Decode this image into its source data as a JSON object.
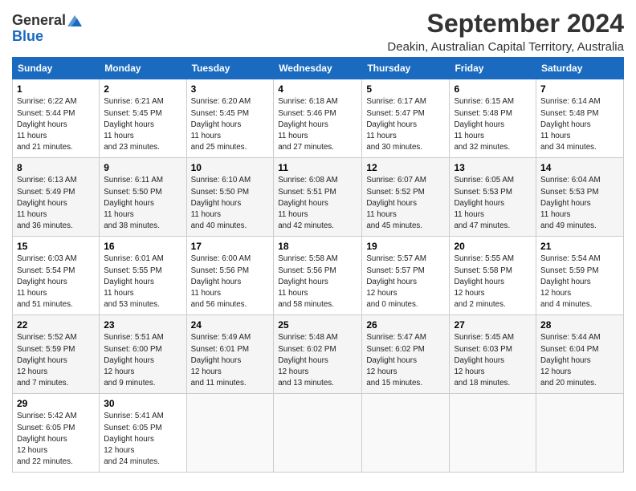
{
  "header": {
    "logo_general": "General",
    "logo_blue": "Blue",
    "month_title": "September 2024",
    "location": "Deakin, Australian Capital Territory, Australia"
  },
  "weekdays": [
    "Sunday",
    "Monday",
    "Tuesday",
    "Wednesday",
    "Thursday",
    "Friday",
    "Saturday"
  ],
  "weeks": [
    [
      {
        "day": "1",
        "sunrise": "6:22 AM",
        "sunset": "5:44 PM",
        "daylight": "11 hours and 21 minutes."
      },
      {
        "day": "2",
        "sunrise": "6:21 AM",
        "sunset": "5:45 PM",
        "daylight": "11 hours and 23 minutes."
      },
      {
        "day": "3",
        "sunrise": "6:20 AM",
        "sunset": "5:45 PM",
        "daylight": "11 hours and 25 minutes."
      },
      {
        "day": "4",
        "sunrise": "6:18 AM",
        "sunset": "5:46 PM",
        "daylight": "11 hours and 27 minutes."
      },
      {
        "day": "5",
        "sunrise": "6:17 AM",
        "sunset": "5:47 PM",
        "daylight": "11 hours and 30 minutes."
      },
      {
        "day": "6",
        "sunrise": "6:15 AM",
        "sunset": "5:48 PM",
        "daylight": "11 hours and 32 minutes."
      },
      {
        "day": "7",
        "sunrise": "6:14 AM",
        "sunset": "5:48 PM",
        "daylight": "11 hours and 34 minutes."
      }
    ],
    [
      {
        "day": "8",
        "sunrise": "6:13 AM",
        "sunset": "5:49 PM",
        "daylight": "11 hours and 36 minutes."
      },
      {
        "day": "9",
        "sunrise": "6:11 AM",
        "sunset": "5:50 PM",
        "daylight": "11 hours and 38 minutes."
      },
      {
        "day": "10",
        "sunrise": "6:10 AM",
        "sunset": "5:50 PM",
        "daylight": "11 hours and 40 minutes."
      },
      {
        "day": "11",
        "sunrise": "6:08 AM",
        "sunset": "5:51 PM",
        "daylight": "11 hours and 42 minutes."
      },
      {
        "day": "12",
        "sunrise": "6:07 AM",
        "sunset": "5:52 PM",
        "daylight": "11 hours and 45 minutes."
      },
      {
        "day": "13",
        "sunrise": "6:05 AM",
        "sunset": "5:53 PM",
        "daylight": "11 hours and 47 minutes."
      },
      {
        "day": "14",
        "sunrise": "6:04 AM",
        "sunset": "5:53 PM",
        "daylight": "11 hours and 49 minutes."
      }
    ],
    [
      {
        "day": "15",
        "sunrise": "6:03 AM",
        "sunset": "5:54 PM",
        "daylight": "11 hours and 51 minutes."
      },
      {
        "day": "16",
        "sunrise": "6:01 AM",
        "sunset": "5:55 PM",
        "daylight": "11 hours and 53 minutes."
      },
      {
        "day": "17",
        "sunrise": "6:00 AM",
        "sunset": "5:56 PM",
        "daylight": "11 hours and 56 minutes."
      },
      {
        "day": "18",
        "sunrise": "5:58 AM",
        "sunset": "5:56 PM",
        "daylight": "11 hours and 58 minutes."
      },
      {
        "day": "19",
        "sunrise": "5:57 AM",
        "sunset": "5:57 PM",
        "daylight": "12 hours and 0 minutes."
      },
      {
        "day": "20",
        "sunrise": "5:55 AM",
        "sunset": "5:58 PM",
        "daylight": "12 hours and 2 minutes."
      },
      {
        "day": "21",
        "sunrise": "5:54 AM",
        "sunset": "5:59 PM",
        "daylight": "12 hours and 4 minutes."
      }
    ],
    [
      {
        "day": "22",
        "sunrise": "5:52 AM",
        "sunset": "5:59 PM",
        "daylight": "12 hours and 7 minutes."
      },
      {
        "day": "23",
        "sunrise": "5:51 AM",
        "sunset": "6:00 PM",
        "daylight": "12 hours and 9 minutes."
      },
      {
        "day": "24",
        "sunrise": "5:49 AM",
        "sunset": "6:01 PM",
        "daylight": "12 hours and 11 minutes."
      },
      {
        "day": "25",
        "sunrise": "5:48 AM",
        "sunset": "6:02 PM",
        "daylight": "12 hours and 13 minutes."
      },
      {
        "day": "26",
        "sunrise": "5:47 AM",
        "sunset": "6:02 PM",
        "daylight": "12 hours and 15 minutes."
      },
      {
        "day": "27",
        "sunrise": "5:45 AM",
        "sunset": "6:03 PM",
        "daylight": "12 hours and 18 minutes."
      },
      {
        "day": "28",
        "sunrise": "5:44 AM",
        "sunset": "6:04 PM",
        "daylight": "12 hours and 20 minutes."
      }
    ],
    [
      {
        "day": "29",
        "sunrise": "5:42 AM",
        "sunset": "6:05 PM",
        "daylight": "12 hours and 22 minutes."
      },
      {
        "day": "30",
        "sunrise": "5:41 AM",
        "sunset": "6:05 PM",
        "daylight": "12 hours and 24 minutes."
      },
      null,
      null,
      null,
      null,
      null
    ]
  ]
}
